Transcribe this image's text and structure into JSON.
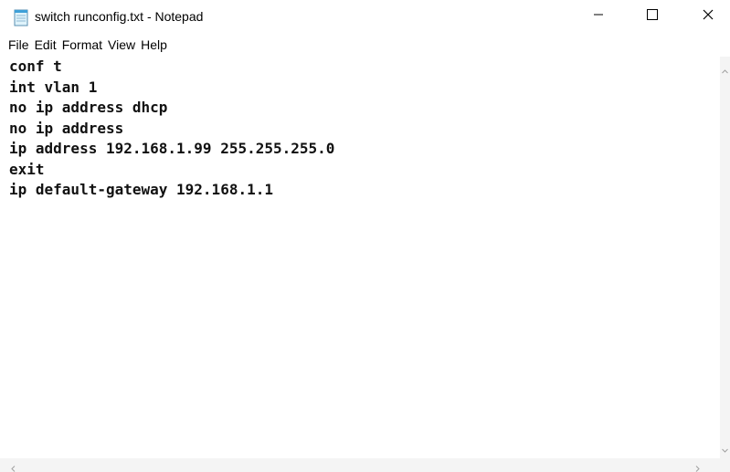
{
  "window": {
    "title": "switch runconfig.txt - Notepad",
    "icon": "notepad-icon"
  },
  "controls": {
    "minimize": "minimize-icon",
    "maximize": "maximize-icon",
    "close": "close-icon"
  },
  "menu": {
    "items": [
      {
        "label": "File"
      },
      {
        "label": "Edit"
      },
      {
        "label": "Format"
      },
      {
        "label": "View"
      },
      {
        "label": "Help"
      }
    ]
  },
  "editor": {
    "lines": [
      "conf t",
      "int vlan 1",
      "no ip address dhcp",
      "no ip address",
      "ip address 192.168.1.99 255.255.255.0",
      "exit",
      "ip default-gateway 192.168.1.1"
    ]
  },
  "colors": {
    "background": "#ffffff",
    "scrollbar": "#f4f4f4",
    "text": "#111111"
  }
}
